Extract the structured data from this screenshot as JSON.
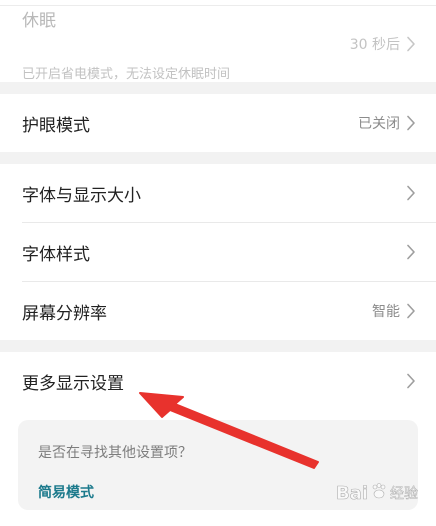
{
  "settings": {
    "sleep": {
      "label": "休眠",
      "subtitle": "已开启省电模式，无法设定休眠时间",
      "value": "30 秒后"
    },
    "eye_comfort": {
      "label": "护眼模式",
      "value": "已关闭"
    },
    "font_display_size": {
      "label": "字体与显示大小"
    },
    "font_style": {
      "label": "字体样式"
    },
    "resolution": {
      "label": "屏幕分辨率",
      "value": "智能"
    },
    "more_display": {
      "label": "更多显示设置"
    }
  },
  "suggestion": {
    "question": "是否在寻找其他设置项？",
    "link": "简易模式"
  },
  "watermark": {
    "brand": "Bai",
    "suffix": "经验"
  },
  "colors": {
    "accent_link": "#1c7a8c",
    "annotation_arrow": "#e8322d"
  },
  "icons": {
    "chevron": "chevron-right-icon",
    "watermark_paw": "baidu-paw-icon"
  }
}
